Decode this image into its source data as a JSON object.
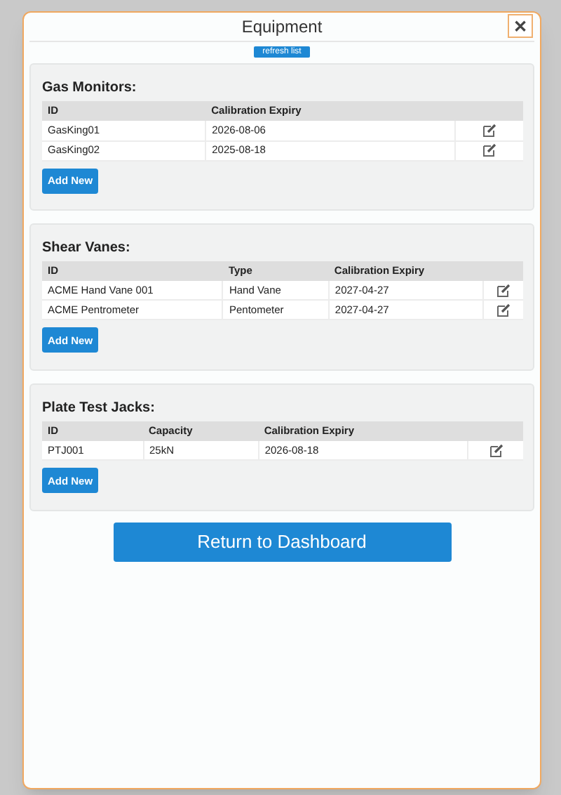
{
  "dialog": {
    "title": "Equipment",
    "close": "✕",
    "refresh": "refresh list"
  },
  "sections": [
    {
      "title": "Gas Monitors:",
      "columns": [
        "ID",
        "Calibration Expiry"
      ],
      "rows": [
        [
          "GasKing01",
          "2026-08-06"
        ],
        [
          "GasKing02",
          "2025-08-18"
        ]
      ],
      "add": "Add New"
    },
    {
      "title": "Shear Vanes:",
      "columns": [
        "ID",
        "Type",
        "Calibration Expiry"
      ],
      "rows": [
        [
          "ACME Hand Vane 001",
          "Hand Vane",
          "2027-04-27"
        ],
        [
          "ACME Pentrometer",
          "Pentometer",
          "2027-04-27"
        ]
      ],
      "add": "Add New"
    },
    {
      "title": "Plate Test Jacks:",
      "columns": [
        "ID",
        "Capacity",
        "Calibration Expiry"
      ],
      "rows": [
        [
          "PTJ001",
          "25kN",
          "2026-08-18"
        ]
      ],
      "add": "Add New"
    }
  ],
  "footer_button": "Return to Dashboard"
}
